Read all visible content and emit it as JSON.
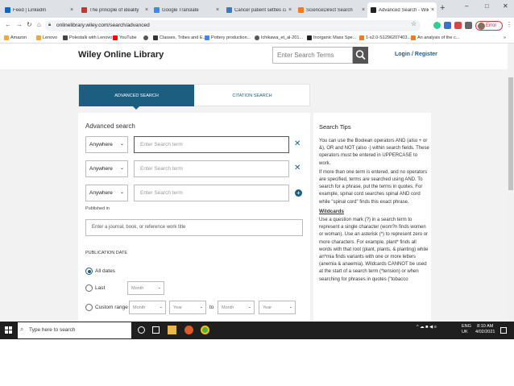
{
  "browser": {
    "tabs": [
      {
        "title": "Feed | LinkedIn",
        "color": "#0a66c2"
      },
      {
        "title": "The principle of ideality",
        "color": "#cc3333"
      },
      {
        "title": "Google Translate",
        "color": "#4285f4"
      },
      {
        "title": "Cancer patient settles case ·",
        "color": "#3a7bbf"
      },
      {
        "title": "ScienceDirect Search",
        "color": "#f47a20"
      },
      {
        "title": "Advanced Search - Wiley Or",
        "color": "#222222"
      }
    ],
    "new_tab": "+",
    "window_controls": {
      "minimize": "–",
      "maximize": "□",
      "close": "✕"
    },
    "url": "onlinelibrary.wiley.com/search/advanced",
    "profile_label": "Error",
    "bookmarks": [
      {
        "label": "Amazon",
        "color": "#f2a93b"
      },
      {
        "label": "Lenovo",
        "color": "#e2231a"
      },
      {
        "label": "Polestalk with Lenovo",
        "color": "#444444"
      },
      {
        "label": "YouTube",
        "color": "#ff0000"
      },
      {
        "label": "",
        "color": "#555555"
      },
      {
        "label": "Classes, Tribes and E...",
        "color": "#333333"
      },
      {
        "label": "Pottery production...",
        "color": "#4285f4"
      },
      {
        "label": "Ichikawa_et_al-201...",
        "color": "#555555"
      },
      {
        "label": "Inorganic Mass Spe...",
        "color": "#222222"
      },
      {
        "label": "1-s2.0-S1296207403...",
        "color": "#f47a20"
      },
      {
        "label": "An analysis of the c...",
        "color": "#f47a20"
      }
    ]
  },
  "site": {
    "logo": "Wiley Online Library",
    "search_placeholder": "Enter Search Terms",
    "login": "Login / Register"
  },
  "search_tabs": {
    "advanced": "ADVANCED SEARCH",
    "citation": "CITATION SEARCH"
  },
  "form": {
    "title": "Advanced search",
    "rows": [
      {
        "field": "Anywhere",
        "placeholder": "Enter Search term",
        "action": "✕"
      },
      {
        "field": "Anywhere",
        "placeholder": "Enter Search term",
        "action": "✕"
      },
      {
        "field": "Anywhere",
        "placeholder": "Enter Search term",
        "action": "+"
      }
    ],
    "published_in_label": "Published in",
    "published_in_placeholder": "Enter a journal, book, or reference work title",
    "publication_date_label": "PUBLICATION DATE",
    "options": {
      "all_dates": "All dates",
      "last": "Last",
      "custom_range": "Custom range"
    },
    "month_placeholder": "Month",
    "year_placeholder": "Year",
    "to": "to"
  },
  "tips": {
    "title": "Search Tips",
    "paragraphs": [
      "You can use the Boolean operators AND (also + or &), OR and NOT (also -) within search fields. These operators must be entered in UPPERCASE to work.",
      "If more than one term is entered, and no operators are specified, terms are searched using AND. To search for a phrase, put the terms in quotes. For example, spinal cord searches spinal AND cord while \"spinal cord\" finds this exact phrase."
    ],
    "wildcards_title": "Wildcards",
    "wildcards_text": "Use a question mark (?) in a search term to represent a single character (wom?n finds women or woman). Use an asterisk (*) to represent zero or more characters. For example, plant* finds all words with that root (plant, plants, & planting) while an*mia finds variants with one or more letters (anemia & anaemia). Wildcards CANNOT be used at the start of a search term (*tension) or when searching for phrases in quotes (\"tobacco"
  },
  "taskbar": {
    "search_placeholder": "Type here to search",
    "tray": "^ ☁ ■ ◀ ≡",
    "lang_1": "ENG",
    "lang_2": "UK",
    "time": "8:10 AM",
    "date": "4/02/2021"
  }
}
